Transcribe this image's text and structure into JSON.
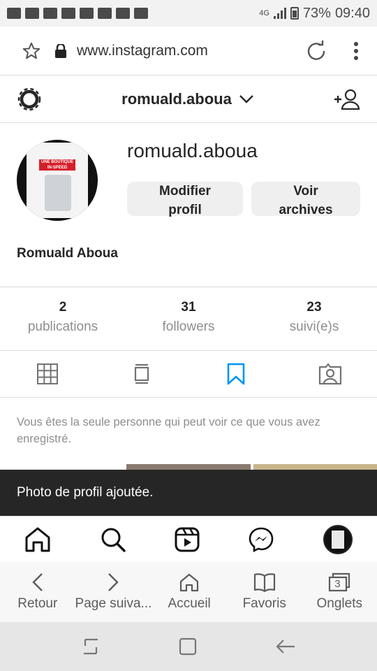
{
  "status_bar": {
    "network": "4G",
    "battery": "73%",
    "time": "09:40"
  },
  "browser": {
    "url": "www.instagram.com"
  },
  "ig_header": {
    "username": "romuald.aboua"
  },
  "profile": {
    "username": "romuald.aboua",
    "edit_label": "Modifier profil",
    "archive_label": "Voir archives",
    "display_name": "Romuald Aboua",
    "avatar_text": "UNE BOUTIQUE IN-SPEED"
  },
  "stats": [
    {
      "value": "2",
      "label": "publications"
    },
    {
      "value": "31",
      "label": "followers"
    },
    {
      "value": "23",
      "label": "suivi(e)s"
    }
  ],
  "saved_note": "Vous êtes la seule personne qui peut voir ce que vous avez enregistré.",
  "toast": "Photo de profil ajoutée.",
  "browser_toolbar": [
    {
      "label": "Retour",
      "icon": "back-chevron-icon"
    },
    {
      "label": "Page suiva...",
      "icon": "forward-chevron-icon"
    },
    {
      "label": "Accueil",
      "icon": "home-icon"
    },
    {
      "label": "Favoris",
      "icon": "bookmarks-book-icon"
    },
    {
      "label": "Onglets",
      "icon": "tabs-icon",
      "count": "3"
    }
  ],
  "colors": {
    "accent": "#0095f6",
    "text": "#262626",
    "muted": "#8e8e8e",
    "button_bg": "#efefef",
    "toast_bg": "#262626"
  }
}
